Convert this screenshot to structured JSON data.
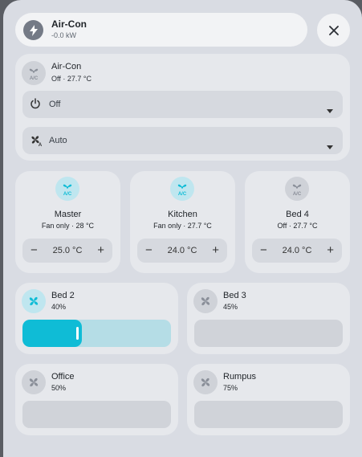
{
  "header": {
    "title": "Air-Con",
    "subtitle": "-0.0 kW"
  },
  "main_unit": {
    "name": "Air-Con",
    "state": "Off · 27.7 °C",
    "mode_select": {
      "value": "Off",
      "icon": "power-icon"
    },
    "fan_select": {
      "value": "Auto",
      "icon": "fan-auto-icon"
    }
  },
  "zones": [
    {
      "name": "Master",
      "state": "Fan only · 28 °C",
      "setpoint": "25.0 °C",
      "active": true
    },
    {
      "name": "Kitchen",
      "state": "Fan only · 27.7 °C",
      "setpoint": "24.0 °C",
      "active": true
    },
    {
      "name": "Bed 4",
      "state": "Off · 27.7 °C",
      "setpoint": "24.0 °C",
      "active": false
    }
  ],
  "fans": [
    {
      "name": "Bed 2",
      "percent_label": "40%",
      "level": 0.4,
      "active": true
    },
    {
      "name": "Bed 3",
      "percent_label": "45%",
      "level": 0.45,
      "active": false
    },
    {
      "name": "Office",
      "percent_label": "50%",
      "level": 0.5,
      "active": false
    },
    {
      "name": "Rumpus",
      "percent_label": "75%",
      "level": 0.75,
      "active": false
    }
  ],
  "stepper": {
    "minus": "−",
    "plus": "+"
  },
  "ac_badge": "A/C",
  "colors": {
    "accent": "#0fbcd6",
    "accent_soft": "#bfe6ef",
    "icon_off": "#8a8f99",
    "card": "#e6e8ec",
    "panel": "#d9dce3"
  }
}
